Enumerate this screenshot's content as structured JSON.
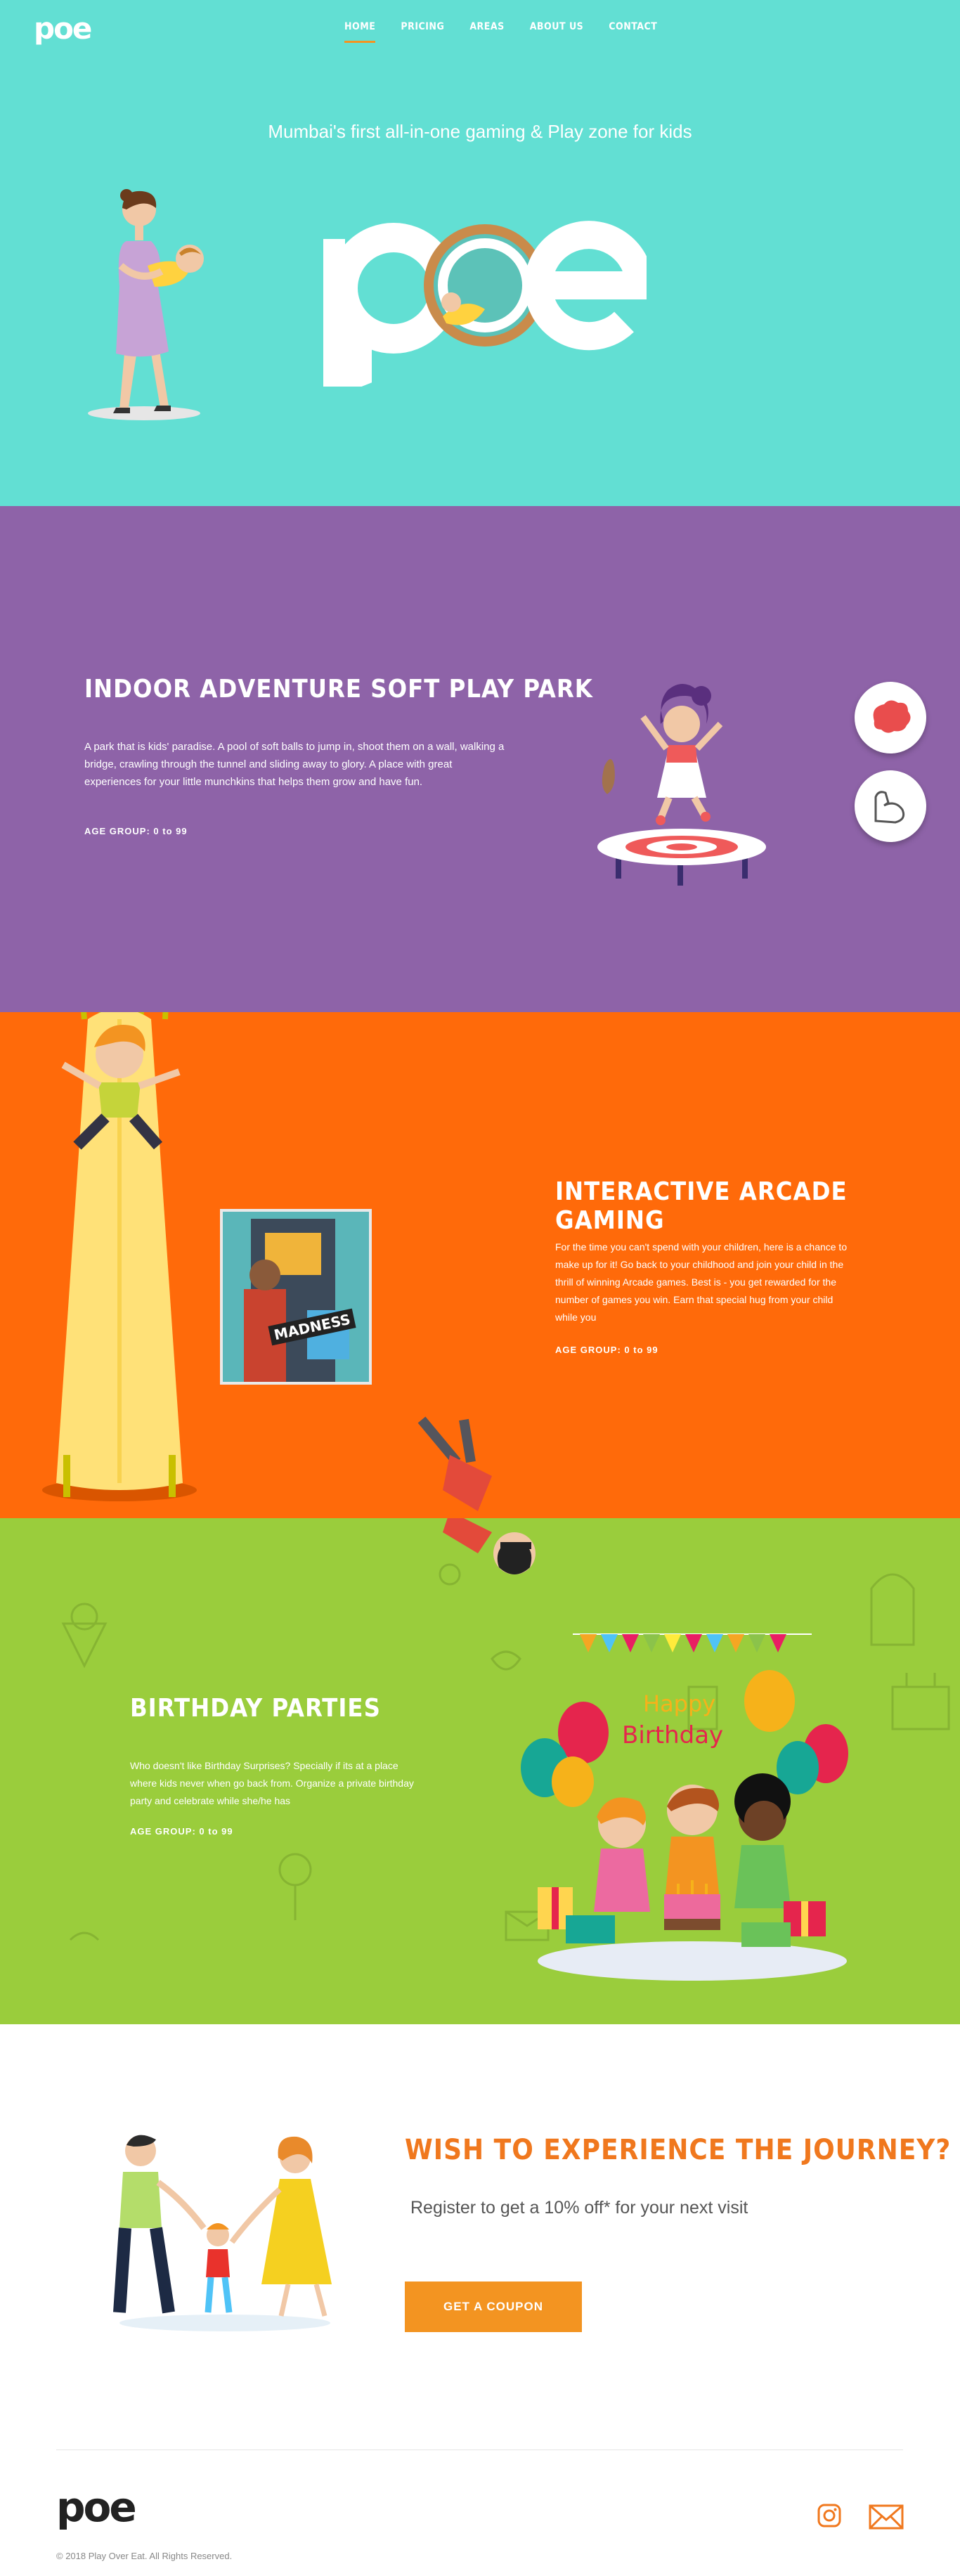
{
  "nav": {
    "logo": "poe",
    "items": [
      {
        "label": "HOME",
        "active": true
      },
      {
        "label": "PRICING",
        "active": false
      },
      {
        "label": "AREAS",
        "active": false
      },
      {
        "label": "ABOUT US",
        "active": false
      },
      {
        "label": "CONTACT",
        "active": false
      }
    ]
  },
  "hero": {
    "tagline": "Mumbai's first all-in-one gaming & Play zone for kids",
    "brand": "poe"
  },
  "softplay": {
    "title": "INDOOR ADVENTURE SOFT PLAY PARK",
    "description": "A park that is kids' paradise. A pool of soft balls to jump in, shoot them on a wall, walking a bridge, crawling through the tunnel and sliding away to glory. A place with great experiences for your little munchkins that helps them grow and have fun.",
    "age_label": "AGE GROUP:",
    "age_value": "0 to 99"
  },
  "arcade": {
    "title": "INTERACTIVE ARCADE GAMING",
    "description": "For the time you can't spend with your children, here is a chance to make up for it! Go back to your childhood and join your child in the thrill of winning Arcade games. Best is - you get rewarded for the number of games you win. Earn that special hug from your child while you",
    "age_label": "AGE GROUP:",
    "age_value": "0 to 99",
    "poster_text": "MADNESS"
  },
  "birthday": {
    "title": "BIRTHDAY PARTIES",
    "description": "Who doesn't like Birthday Surprises? Specially if its at a place where kids never when go back from. Organize a private birthday party and celebrate while she/he has",
    "age_label": "AGE GROUP:",
    "age_value": "0 to 99",
    "banner_happy": "Happy",
    "banner_birthday": "Birthday"
  },
  "journey": {
    "title": "WISH TO EXPERIENCE THE JOURNEY?",
    "subtitle": "Register to get a 10% off* for your next visit",
    "cta_label": "GET A COUPON"
  },
  "footer": {
    "logo": "poe",
    "copyright": "© 2018 Play Over Eat. All Rights Reserved."
  },
  "colors": {
    "teal": "#62dfd3",
    "purple": "#8e63a8",
    "orange": "#ff6a0a",
    "green": "#9acd3c",
    "accent": "#f39421"
  }
}
